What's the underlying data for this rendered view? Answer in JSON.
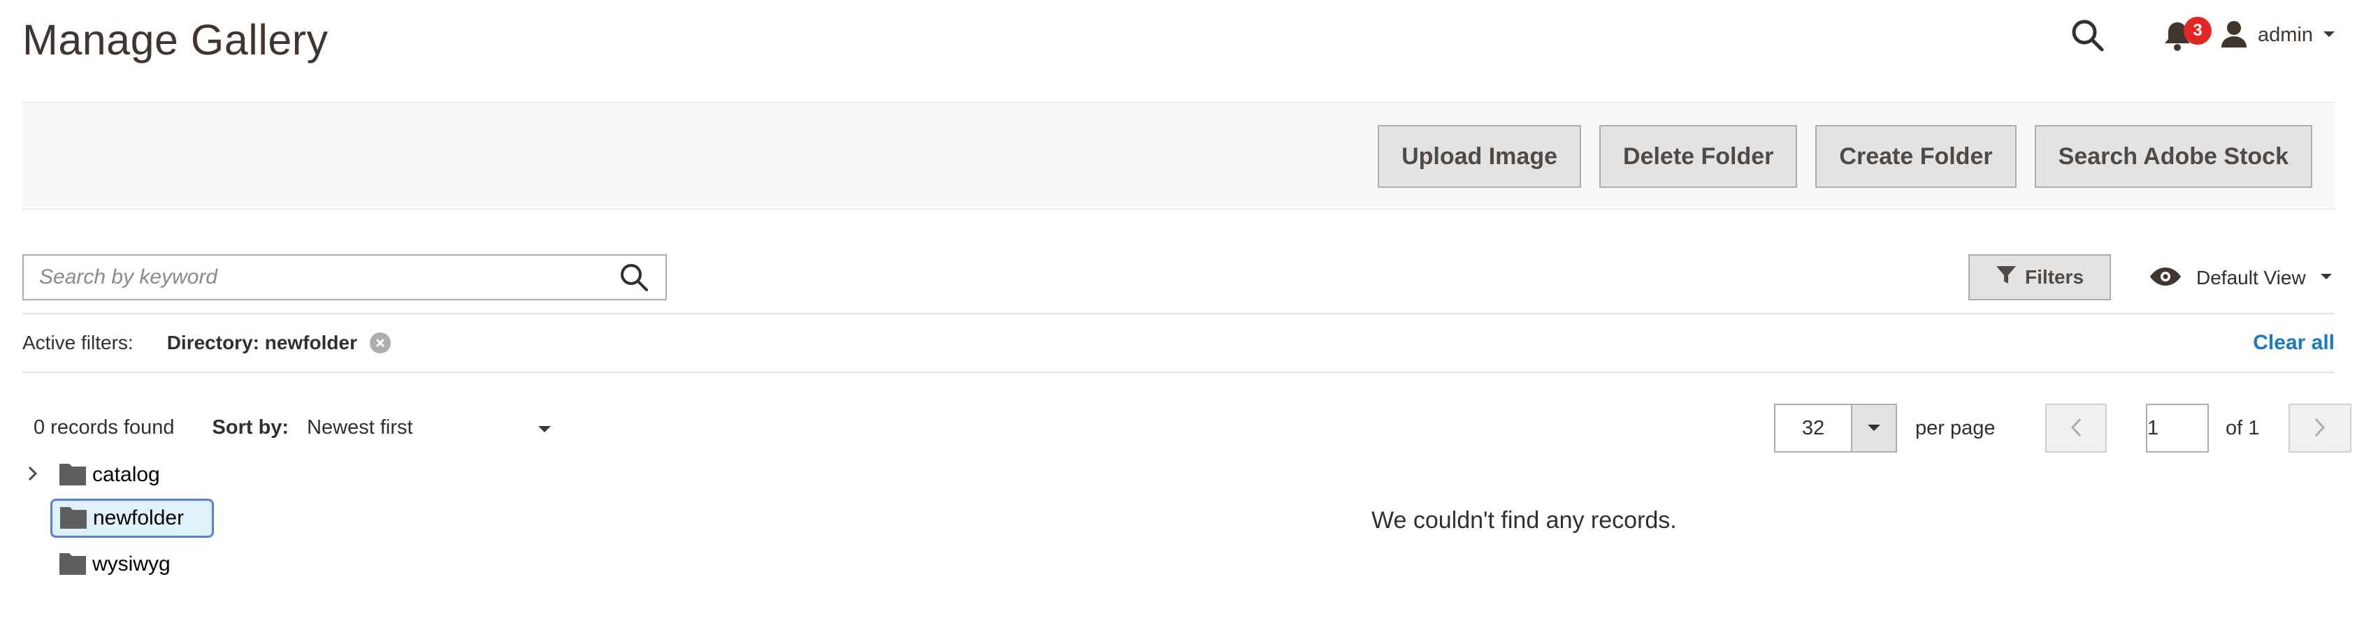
{
  "page": {
    "title": "Manage Gallery"
  },
  "header": {
    "notifications_count": "3",
    "user_name": "admin"
  },
  "toolbar": {
    "buttons": [
      "Upload Image",
      "Delete Folder",
      "Create Folder",
      "Search Adobe Stock"
    ]
  },
  "search": {
    "placeholder": "Search by keyword",
    "value": ""
  },
  "filters": {
    "button_label": "Filters"
  },
  "view": {
    "label": "Default View"
  },
  "active_filters": {
    "title": "Active filters:",
    "chip": "Directory: newfolder",
    "clear_all": "Clear all"
  },
  "records": {
    "count_text": "0 records found",
    "sort_label": "Sort by:",
    "sort_value": "Newest first",
    "empty_message": "We couldn't find any records."
  },
  "pagination": {
    "per_page_value": "32",
    "per_page_label": "per page",
    "current_page": "1",
    "of_text": "of 1"
  },
  "tree": {
    "items": [
      {
        "label": "catalog",
        "expandable": true,
        "selected": false
      },
      {
        "label": "newfolder",
        "expandable": false,
        "selected": true
      },
      {
        "label": "wysiwyg",
        "expandable": false,
        "selected": false
      }
    ]
  },
  "colors": {
    "accent_link": "#1979c3",
    "badge": "#e22626",
    "selected_bg": "#dff2fb",
    "selected_border": "#5a7fd6",
    "button_bg": "#e3e3e3"
  }
}
